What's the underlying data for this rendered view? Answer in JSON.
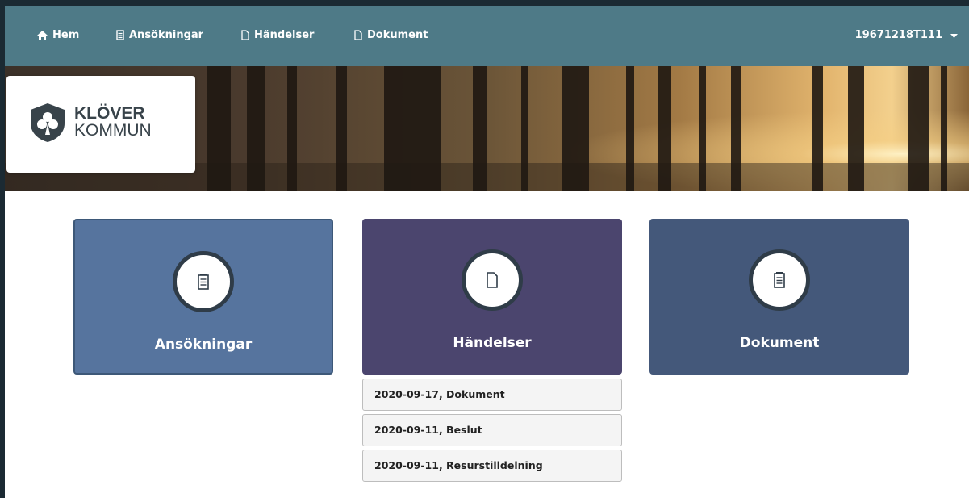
{
  "nav": {
    "items": [
      {
        "label": "Hem",
        "icon": "home-icon"
      },
      {
        "label": "Ansökningar",
        "icon": "notepad-icon"
      },
      {
        "label": "Händelser",
        "icon": "document-icon"
      },
      {
        "label": "Dokument",
        "icon": "document-icon"
      }
    ],
    "user": "19671218T111",
    "user_icon": "caret-down-icon"
  },
  "logo": {
    "line1": "KLÖVER",
    "line2": "KOMMUN",
    "icon": "clover-shield-icon"
  },
  "tiles": [
    {
      "label": "Ansökningar",
      "icon": "notepad-icon",
      "color": "#56749e"
    },
    {
      "label": "Händelser",
      "icon": "document-icon",
      "color": "#4b456e"
    },
    {
      "label": "Dokument",
      "icon": "notepad-icon",
      "color": "#44587a"
    }
  ],
  "events": [
    "2020-09-17,  Dokument",
    "2020-09-11,  Beslut",
    "2020-09-11,  Resurstilldelning"
  ],
  "colors": {
    "navbar": "#4e7a87",
    "frame": "#1b2a33"
  }
}
